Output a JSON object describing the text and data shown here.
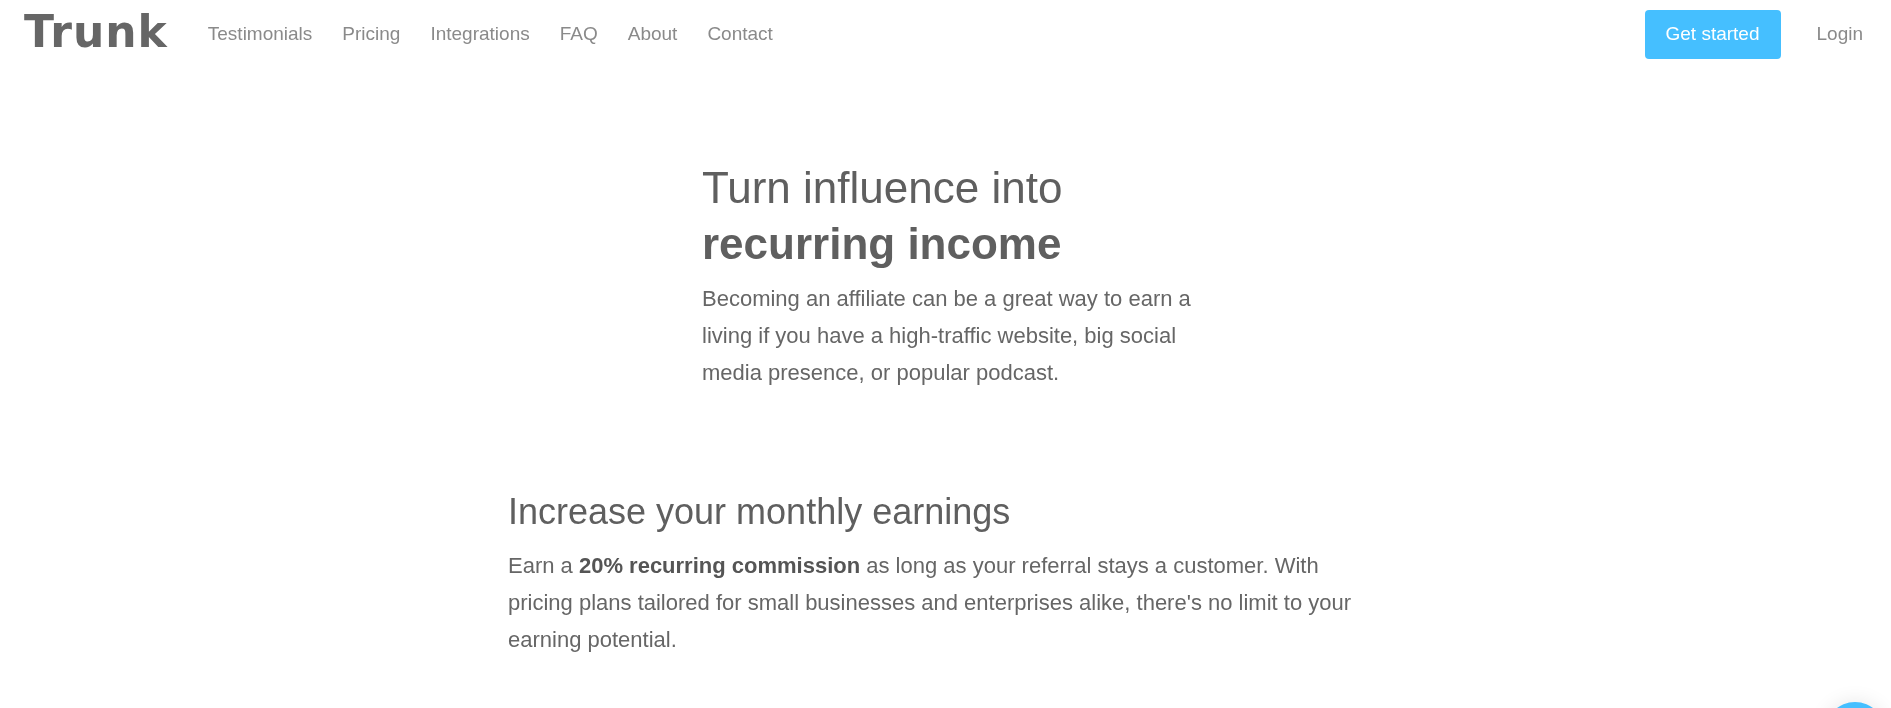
{
  "header": {
    "logo": "Trunk",
    "nav": [
      {
        "label": "Testimonials"
      },
      {
        "label": "Pricing"
      },
      {
        "label": "Integrations"
      },
      {
        "label": "FAQ"
      },
      {
        "label": "About"
      },
      {
        "label": "Contact"
      }
    ],
    "cta": "Get started",
    "login": "Login"
  },
  "hero": {
    "title": "Turn influence into **recurring income**",
    "text": "Becoming an affiliate can be a great way to earn a living if you have a high-traffic website, big social media presence, or popular podcast."
  },
  "section": {
    "heading": "Increase your monthly earnings",
    "text": "Earn a **20% recurring commission** as long as your referral stays a customer. With pricing plans tailored for small businesses and enterprises alike, there's no limit to your earning potential."
  }
}
